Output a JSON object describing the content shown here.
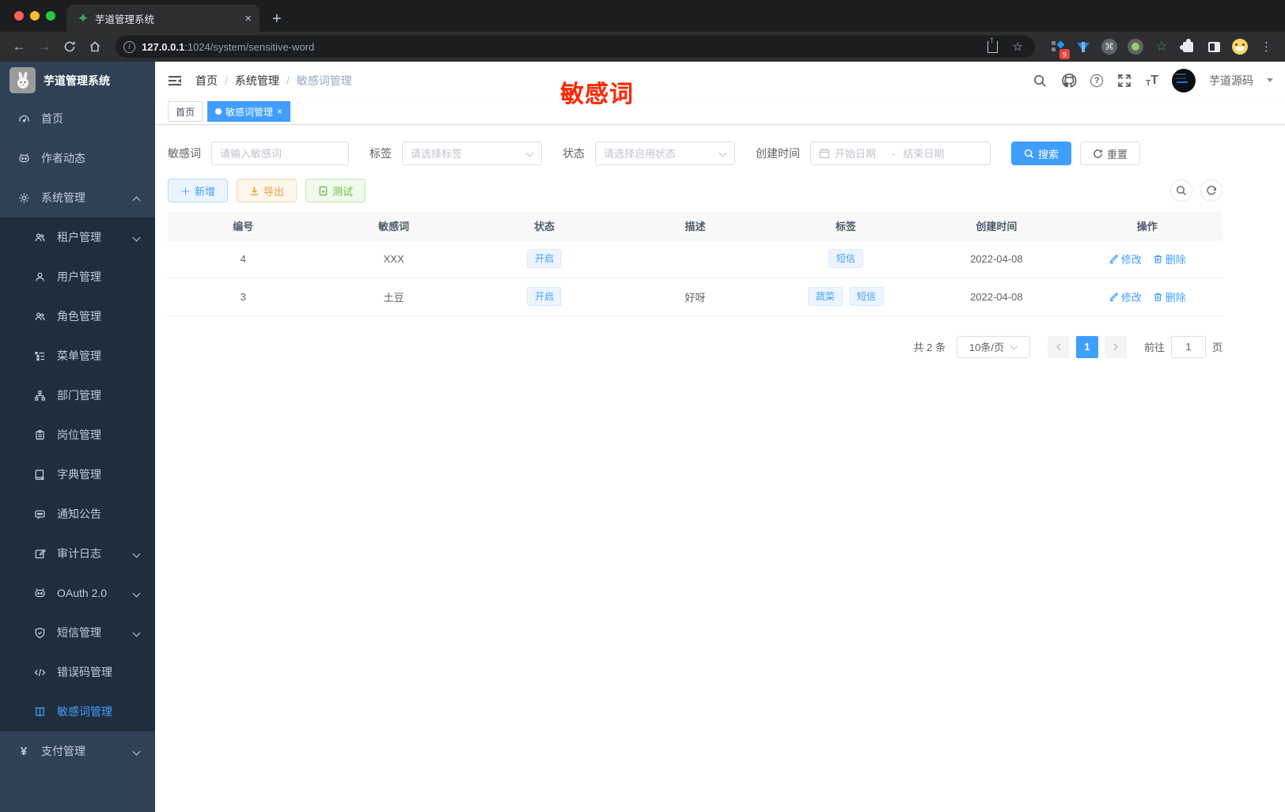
{
  "colors": {
    "primary": "#409eff",
    "warning": "#e6a23c",
    "success": "#67c23a",
    "annotation_red": "#ff2600",
    "sidebar_bg": "#304156",
    "submenu_bg": "#1f2d3d"
  },
  "browser": {
    "tab_title": "芋道管理系统",
    "url_host": "127.0.0.1",
    "url_rest": ":1024/system/sensitive-word",
    "extension_badge": "9"
  },
  "sidebar": {
    "app_title": "芋道管理系统",
    "items": [
      {
        "label": "首页",
        "icon": "dashboard-icon",
        "level": 1
      },
      {
        "label": "作者动态",
        "icon": "author-chat-icon",
        "level": 1
      },
      {
        "label": "系统管理",
        "icon": "gear-icon",
        "level": 1,
        "arrow": "up"
      },
      {
        "label": "租户管理",
        "icon": "tenant-icon",
        "level": 2,
        "arrow": "down"
      },
      {
        "label": "用户管理",
        "icon": "user-icon",
        "level": 2
      },
      {
        "label": "角色管理",
        "icon": "role-icon",
        "level": 2
      },
      {
        "label": "菜单管理",
        "icon": "menu-tree-icon",
        "level": 2
      },
      {
        "label": "部门管理",
        "icon": "dept-icon",
        "level": 2
      },
      {
        "label": "岗位管理",
        "icon": "post-icon",
        "level": 2
      },
      {
        "label": "字典管理",
        "icon": "dict-icon",
        "level": 2
      },
      {
        "label": "通知公告",
        "icon": "notice-icon",
        "level": 2
      },
      {
        "label": "审计日志",
        "icon": "audit-log-icon",
        "level": 2,
        "arrow": "down"
      },
      {
        "label": "OAuth 2.0",
        "icon": "oauth-icon",
        "level": 2,
        "arrow": "down"
      },
      {
        "label": "短信管理",
        "icon": "sms-shield-icon",
        "level": 2,
        "arrow": "down"
      },
      {
        "label": "错误码管理",
        "icon": "error-code-icon",
        "level": 2
      },
      {
        "label": "敏感词管理",
        "icon": "sensitive-word-icon",
        "level": 2,
        "active": true
      },
      {
        "label": "支付管理",
        "icon": "pay-icon",
        "level": 1,
        "arrow": "down"
      }
    ]
  },
  "header": {
    "breadcrumb": {
      "home": "首页",
      "section": "系统管理",
      "current": "敏感词管理"
    },
    "annotation": "敏感词",
    "username": "芋道源码"
  },
  "tags": [
    {
      "label": "首页",
      "active": false
    },
    {
      "label": "敏感词管理",
      "active": true,
      "closable": true
    }
  ],
  "filters": {
    "keyword": {
      "label": "敏感词",
      "placeholder": "请输入敏感词"
    },
    "tag": {
      "label": "标签",
      "placeholder": "请选择标签"
    },
    "status": {
      "label": "状态",
      "placeholder": "请选择启用状态"
    },
    "create_time": {
      "label": "创建时间",
      "start_placeholder": "开始日期",
      "separator": "-",
      "end_placeholder": "结束日期"
    },
    "search_label": "搜索",
    "reset_label": "重置"
  },
  "toolbar": {
    "add_label": "新增",
    "export_label": "导出",
    "test_label": "测试"
  },
  "table": {
    "columns": [
      "编号",
      "敏感词",
      "状态",
      "描述",
      "标签",
      "创建时间",
      "操作"
    ],
    "rows": [
      {
        "id": "4",
        "word": "XXX",
        "status": "开启",
        "description": "",
        "tags": [
          "短信"
        ],
        "create_time": "2022-04-08"
      },
      {
        "id": "3",
        "word": "土豆",
        "status": "开启",
        "description": "好呀",
        "tags": [
          "蔬菜",
          "短信"
        ],
        "create_time": "2022-04-08"
      }
    ],
    "edit_label": "修改",
    "delete_label": "删除"
  },
  "pagination": {
    "total_text": "共 2 条",
    "page_size": "10条/页",
    "current_page": "1",
    "goto_label": "前往",
    "goto_value": "1",
    "page_suffix": "页"
  }
}
